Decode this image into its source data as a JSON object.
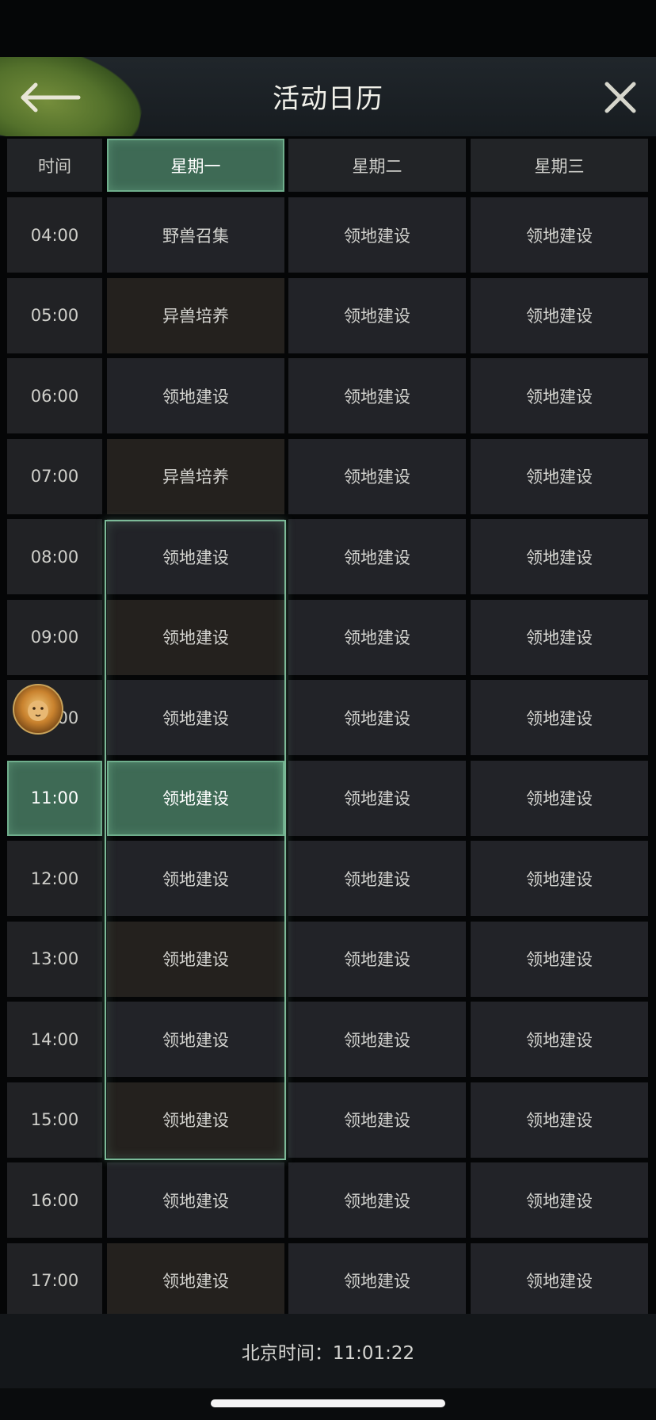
{
  "title": "活动日历",
  "header": {
    "time_label": "时间",
    "days": [
      "星期一",
      "星期二",
      "星期三"
    ]
  },
  "rows": [
    {
      "time": "04:00",
      "cells": [
        "野兽召集",
        "领地建设",
        "领地建设"
      ]
    },
    {
      "time": "05:00",
      "cells": [
        "异兽培养",
        "领地建设",
        "领地建设"
      ]
    },
    {
      "time": "06:00",
      "cells": [
        "领地建设",
        "领地建设",
        "领地建设"
      ]
    },
    {
      "time": "07:00",
      "cells": [
        "异兽培养",
        "领地建设",
        "领地建设"
      ]
    },
    {
      "time": "08:00",
      "cells": [
        "领地建设",
        "领地建设",
        "领地建设"
      ]
    },
    {
      "time": "09:00",
      "cells": [
        "领地建设",
        "领地建设",
        "领地建设"
      ]
    },
    {
      "time": "10:00",
      "cells": [
        "领地建设",
        "领地建设",
        "领地建设"
      ]
    },
    {
      "time": "11:00",
      "cells": [
        "领地建设",
        "领地建设",
        "领地建设"
      ]
    },
    {
      "time": "12:00",
      "cells": [
        "领地建设",
        "领地建设",
        "领地建设"
      ]
    },
    {
      "time": "13:00",
      "cells": [
        "领地建设",
        "领地建设",
        "领地建设"
      ]
    },
    {
      "time": "14:00",
      "cells": [
        "领地建设",
        "领地建设",
        "领地建设"
      ]
    },
    {
      "time": "15:00",
      "cells": [
        "领地建设",
        "领地建设",
        "领地建设"
      ]
    },
    {
      "time": "16:00",
      "cells": [
        "领地建设",
        "领地建设",
        "领地建设"
      ]
    },
    {
      "time": "17:00",
      "cells": [
        "领地建设",
        "领地建设",
        "领地建设"
      ]
    }
  ],
  "current": {
    "day_index": 0,
    "row_index": 7
  },
  "footer": {
    "beijing_time": "北京时间：11:01:22"
  },
  "icons": {
    "back": "back-arrow-icon",
    "close": "close-icon",
    "avatar": "lion-avatar"
  },
  "colors": {
    "accent": "#3e6a55",
    "accent_border": "#7cba98",
    "background": "#050607"
  }
}
